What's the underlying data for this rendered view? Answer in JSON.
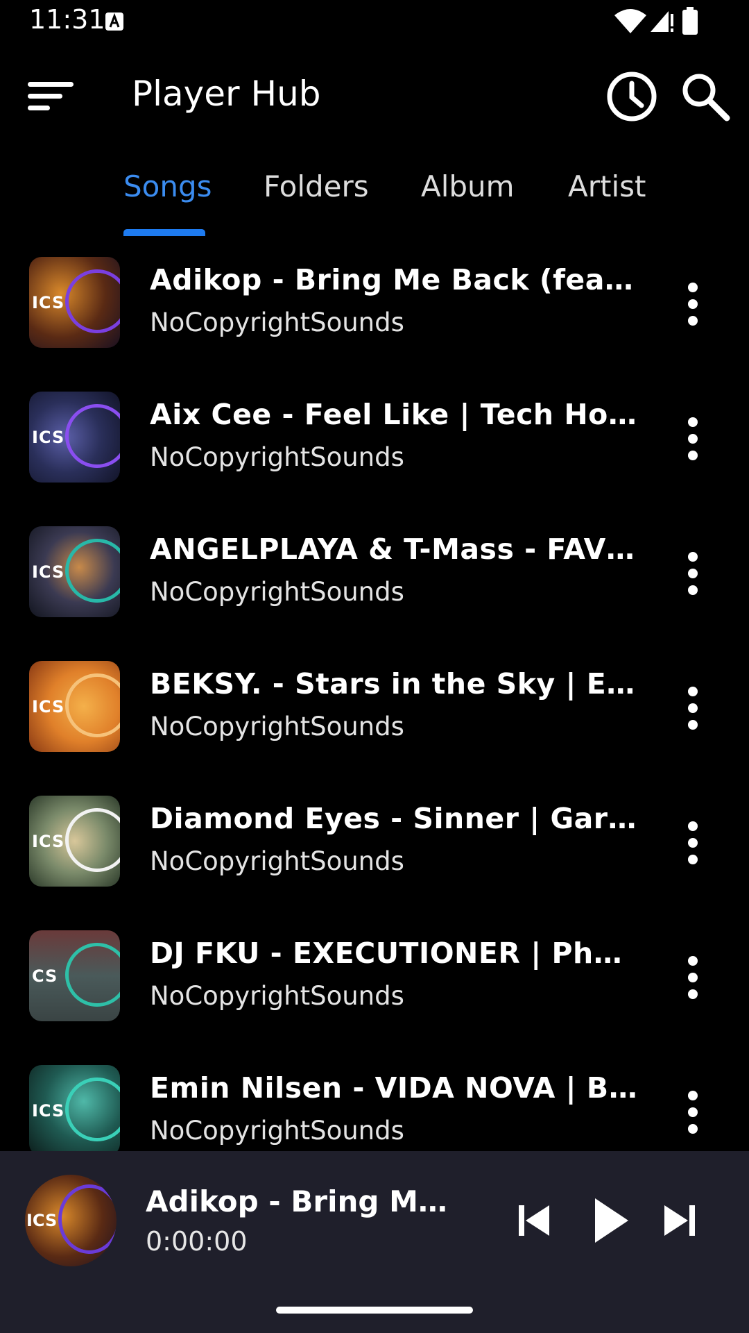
{
  "status_bar": {
    "time": "11:31"
  },
  "app_bar": {
    "title": "Player Hub"
  },
  "tabs": [
    {
      "label": "Songs",
      "active": true
    },
    {
      "label": "Folders",
      "active": false
    },
    {
      "label": "Album",
      "active": false
    },
    {
      "label": "Artist",
      "active": false
    }
  ],
  "songs": [
    {
      "title": "Adikop - Bring Me Back (feat. N...",
      "artist": "NoCopyrightSounds",
      "logo": "ICS"
    },
    {
      "title": "Aix Cee - Feel Like | Tech Hous...",
      "artist": "NoCopyrightSounds",
      "logo": "ICS"
    },
    {
      "title": "ANGELPLAYA & T-Mass - FAVHE...",
      "artist": "NoCopyrightSounds",
      "logo": "ICS"
    },
    {
      "title": "BEKSY. - Stars in the Sky | Elec...",
      "artist": "NoCopyrightSounds",
      "logo": "ICS"
    },
    {
      "title": "Diamond Eyes - Sinner | Garag...",
      "artist": "NoCopyrightSounds",
      "logo": "ICS"
    },
    {
      "title": "DJ FKU - EXECUTIONER | Phonk...",
      "artist": "NoCopyrightSounds",
      "logo": "CS"
    },
    {
      "title": "Emin Nilsen - VIDA NOVA | Bra...",
      "artist": "NoCopyrightSounds",
      "logo": "ICS"
    }
  ],
  "mini_player": {
    "title": "Adikop - Bring Me B...",
    "time": "0:00:00",
    "logo": "ICS"
  },
  "colors": {
    "accent": "#1e7bf0",
    "background": "#000000",
    "player_bg": "#1f1f2b"
  }
}
